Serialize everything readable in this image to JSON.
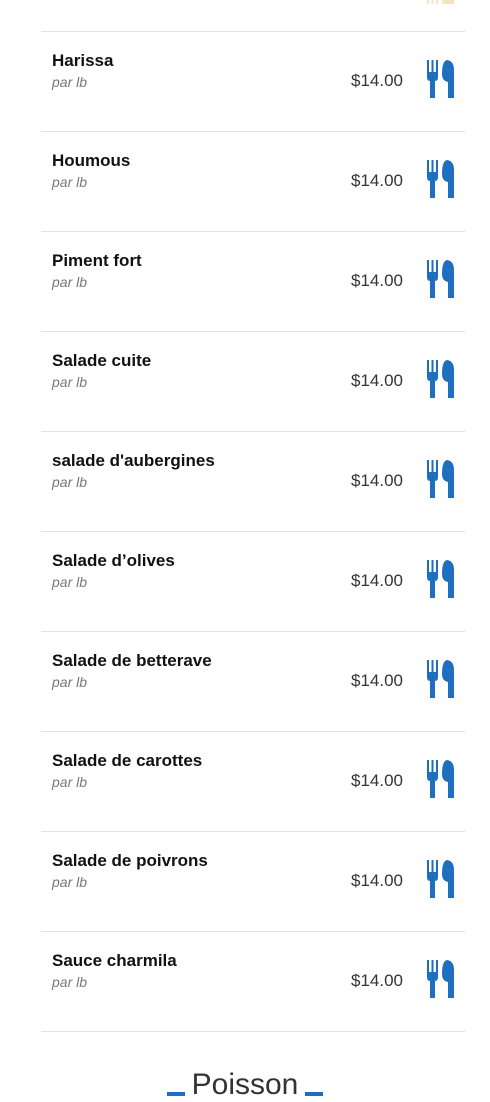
{
  "accent_color": "#1f6fc1",
  "order_icon": "fork-knife-icon",
  "items": [
    {
      "name": "Harissa",
      "unit": "par lb",
      "price": "$14.00"
    },
    {
      "name": "Houmous",
      "unit": "par lb",
      "price": "$14.00"
    },
    {
      "name": "Piment fort",
      "unit": "par lb",
      "price": "$14.00"
    },
    {
      "name": "Salade cuite",
      "unit": "par lb",
      "price": "$14.00"
    },
    {
      "name": "salade d'aubergines",
      "unit": "par lb",
      "price": "$14.00"
    },
    {
      "name": "Salade d’olives",
      "unit": "par lb",
      "price": "$14.00"
    },
    {
      "name": "Salade de betterave",
      "unit": "par lb",
      "price": "$14.00"
    },
    {
      "name": "Salade de carottes",
      "unit": "par lb",
      "price": "$14.00"
    },
    {
      "name": "Salade de poivrons",
      "unit": "par lb",
      "price": "$14.00"
    },
    {
      "name": "Sauce charmila",
      "unit": "par lb",
      "price": "$14.00"
    }
  ],
  "next_section": {
    "title": "Poisson"
  }
}
